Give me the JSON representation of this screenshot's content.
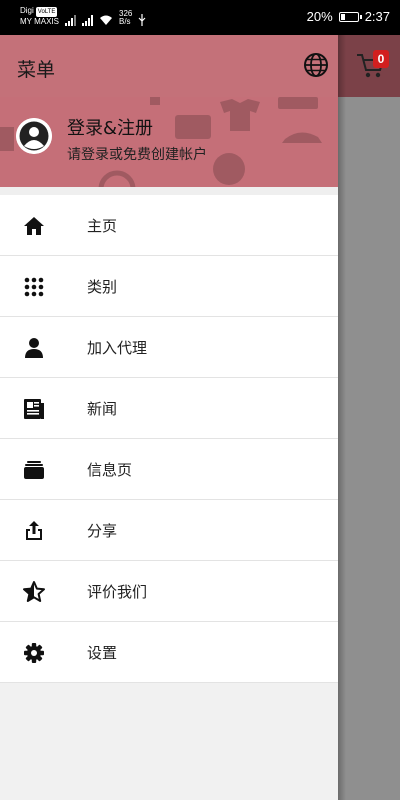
{
  "status_bar": {
    "carrier_top": "Digi",
    "carrier_tag": "VoLTE",
    "carrier_bottom": "MY MAXIS",
    "net_speed_value": "326",
    "net_speed_unit": "B/s",
    "battery": "20%",
    "time": "2:37"
  },
  "background_app": {
    "cart_count": "0"
  },
  "drawer": {
    "title": "菜单",
    "header": {
      "login_title": "登录&注册",
      "login_subtitle": "请登录或免费创建帐户"
    },
    "items": [
      {
        "label": "主页",
        "icon": "home-icon"
      },
      {
        "label": "类别",
        "icon": "apps-grid-icon"
      },
      {
        "label": "加入代理",
        "icon": "person-icon"
      },
      {
        "label": "新闻",
        "icon": "newspaper-icon"
      },
      {
        "label": "信息页",
        "icon": "info-pages-icon"
      },
      {
        "label": "分享",
        "icon": "share-icon"
      },
      {
        "label": "评价我们",
        "icon": "star-half-icon"
      },
      {
        "label": "设置",
        "icon": "gear-icon"
      }
    ]
  },
  "colors": {
    "appbar": "#c47179",
    "header": "#c56f78",
    "badge": "#d21f1f"
  }
}
